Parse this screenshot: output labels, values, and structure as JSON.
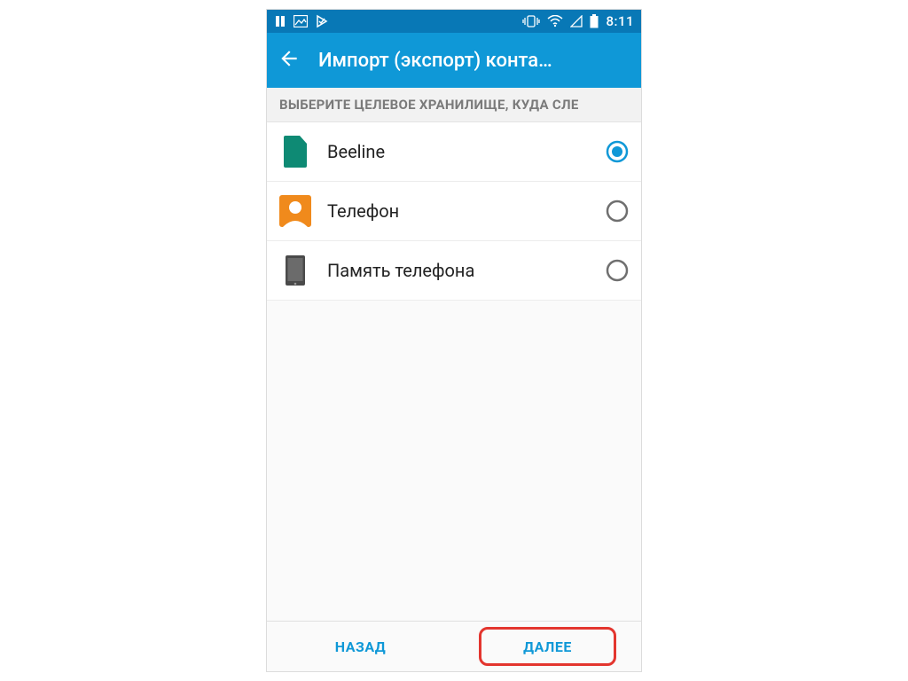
{
  "statusbar": {
    "clock": "8:11"
  },
  "appbar": {
    "title": "Импорт (экспорт) конта…"
  },
  "section": {
    "header": "ВЫБЕРИТЕ ЦЕЛЕВОЕ ХРАНИЛИЩЕ, КУДА СЛЕ"
  },
  "storage": {
    "items": [
      {
        "label": "Beeline",
        "icon": "sim",
        "selected": true
      },
      {
        "label": "Телефон",
        "icon": "contact",
        "selected": false
      },
      {
        "label": "Память телефона",
        "icon": "device",
        "selected": false
      }
    ]
  },
  "buttons": {
    "back": "НАЗАД",
    "next": "ДАЛЕЕ"
  },
  "colors": {
    "accent": "#0f98d7",
    "statusbar": "#0878b6",
    "sim": "#0e8a74",
    "contact": "#f08a1c",
    "highlight": "#e3352e"
  }
}
